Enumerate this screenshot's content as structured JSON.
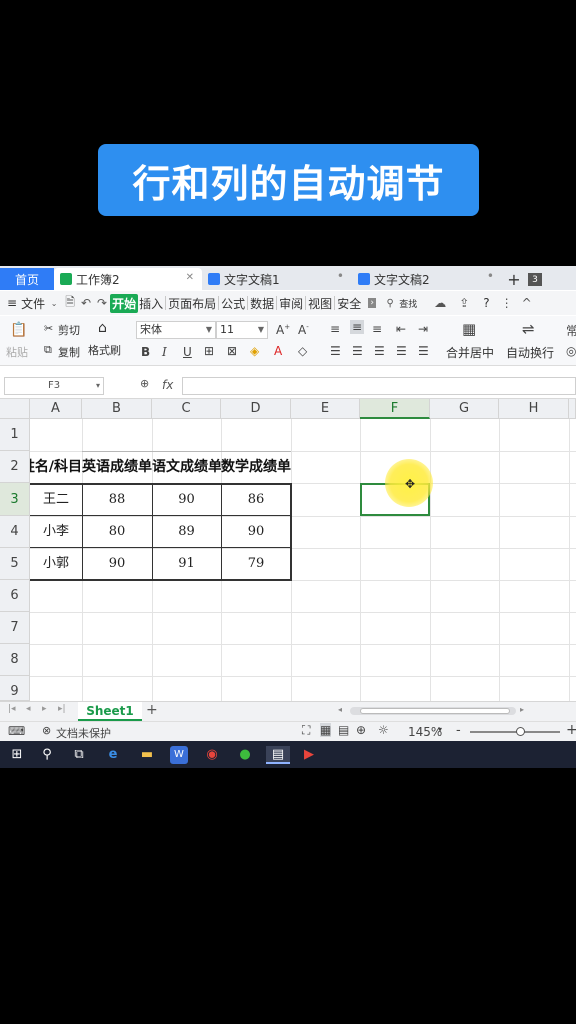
{
  "banner": {
    "text": "行和列的自动调节"
  },
  "tabs": {
    "home": "首页",
    "items": [
      {
        "label": "工作簿2",
        "color": "#1aaa55",
        "active": true
      },
      {
        "label": "文字文稿1",
        "color": "#2f7cf6",
        "active": false
      },
      {
        "label": "文字文稿2",
        "color": "#2f7cf6",
        "active": false
      }
    ],
    "plus": "+"
  },
  "menu": {
    "hamburger": "≡",
    "file": "文件",
    "items": [
      "开始",
      "插入",
      "页面布局",
      "公式",
      "数据",
      "审阅",
      "视图",
      "安全"
    ],
    "search": "查找",
    "help": "?"
  },
  "ribbon": {
    "paste": "粘贴",
    "cut": "剪切",
    "copy": "复制",
    "format_painter": "格式刷",
    "font_name": "宋体",
    "font_size": "11",
    "bold": "B",
    "italic": "I",
    "underline": "U",
    "merge_center": "合并居中",
    "wrap_text": "自动换行"
  },
  "formula_bar": {
    "name_box": "F3",
    "fx": "fx",
    "value": ""
  },
  "columns": [
    "A",
    "B",
    "C",
    "D",
    "E",
    "F",
    "G",
    "H"
  ],
  "selected_column": "F",
  "rows": [
    "1",
    "2",
    "3",
    "4",
    "5",
    "6",
    "7",
    "8",
    "9"
  ],
  "table": {
    "header": [
      "姓名/科目",
      "英语成绩单",
      "语文成绩单",
      "数学成绩单"
    ],
    "body": [
      [
        "王二",
        "88",
        "90",
        "86"
      ],
      [
        "小李",
        "80",
        "89",
        "90"
      ],
      [
        "小郭",
        "90",
        "91",
        "79"
      ]
    ]
  },
  "sheet": {
    "name": "Sheet1",
    "add": "+"
  },
  "status": {
    "protect": "文档未保护",
    "zoom": "145%",
    "zoom_minus": "-",
    "zoom_plus": "+"
  },
  "taskbar": {
    "icons": [
      "windows-start",
      "search",
      "task-view",
      "edge",
      "file-explorer",
      "wps",
      "chrome",
      "wechat",
      "wps-spreadsheet",
      "media-app"
    ]
  }
}
